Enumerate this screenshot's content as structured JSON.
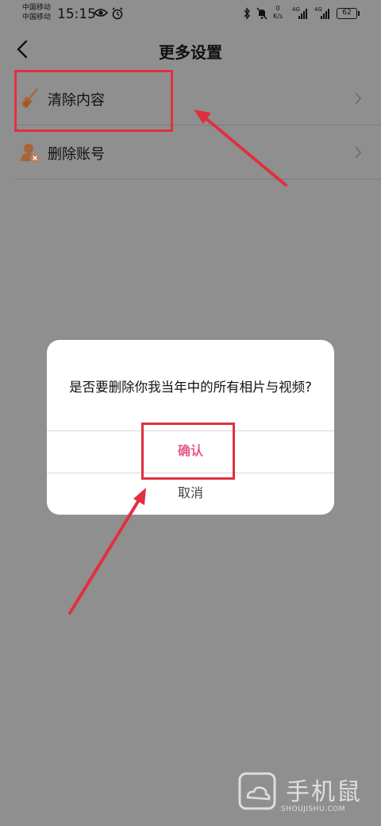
{
  "status_bar": {
    "carrier_1": "中国移动",
    "carrier_2": "中国移动",
    "time": "15:15",
    "net_speed_value": "0",
    "net_speed_unit": "K/s",
    "signal_tag": "4G",
    "battery": "62"
  },
  "header": {
    "title": "更多设置",
    "back_icon": "chevron-left-icon"
  },
  "settings": {
    "items": [
      {
        "label": "清除内容",
        "icon": "broom-icon"
      },
      {
        "label": "删除账号",
        "icon": "user-remove-icon"
      }
    ]
  },
  "dialog": {
    "message": "是否要删除你我当年中的所有相片与视频?",
    "confirm_label": "确认",
    "cancel_label": "取消"
  },
  "watermark": {
    "text": "手机鼠",
    "subtext": "SHOUJISHU.COM"
  },
  "colors": {
    "overlay": "#8f8f8f",
    "confirm": "#e65a8a",
    "annotation": "#e03040",
    "icon_brown": "#a8653a"
  }
}
